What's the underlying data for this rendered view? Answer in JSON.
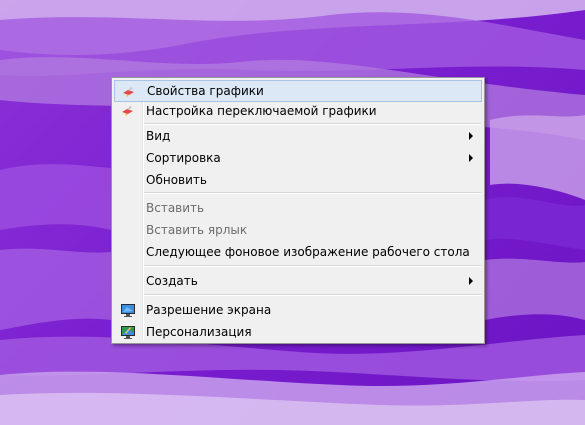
{
  "desktop": {
    "wallpaper_colors": [
      "#8a32d8",
      "#7a1fd0",
      "#6b13c4",
      "#c99ae8",
      "#b071e0"
    ]
  },
  "context_menu": {
    "items": [
      {
        "label": "Свойства графики",
        "icon": "graphics-properties-icon",
        "state": "hover"
      },
      {
        "label": "Настройка переключаемой графики",
        "icon": "switchable-graphics-icon"
      },
      {
        "label": "Вид",
        "submenu": true
      },
      {
        "label": "Сортировка",
        "submenu": true
      },
      {
        "label": "Обновить"
      },
      {
        "label": "Вставить",
        "disabled": true
      },
      {
        "label": "Вставить ярлык",
        "disabled": true
      },
      {
        "label": "Следующее фоновое изображение рабочего стола"
      },
      {
        "label": "Создать",
        "submenu": true
      },
      {
        "label": "Разрешение экрана",
        "icon": "screen-resolution-icon"
      },
      {
        "label": "Персонализация",
        "icon": "personalization-icon"
      }
    ]
  }
}
